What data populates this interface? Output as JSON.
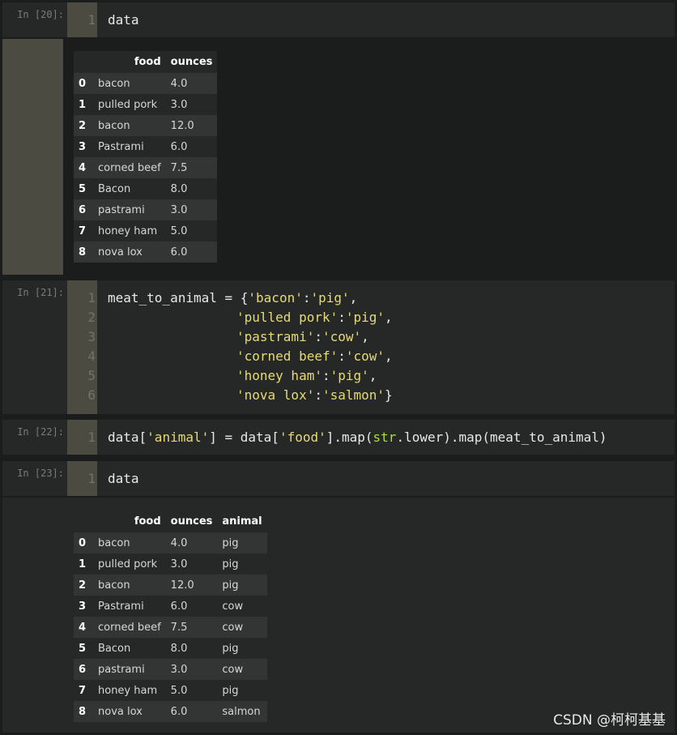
{
  "cells": [
    {
      "prompt": "In [20]:",
      "lines": [
        "1"
      ],
      "code": [
        "data"
      ]
    },
    {
      "prompt": "In [21]:",
      "lines": [
        "1",
        "2",
        "3",
        "4",
        "5",
        "6"
      ]
    },
    {
      "prompt": "In [22]:",
      "lines": [
        "1"
      ]
    },
    {
      "prompt": "In [23]:",
      "lines": [
        "1"
      ],
      "code": [
        "data"
      ]
    }
  ],
  "code21": {
    "l1a": "meat_to_animal ",
    "l1b": "= ",
    "l1c": "{",
    "l1d": "'bacon'",
    "l1e": ":",
    "l1f": "'pig'",
    "l1g": ",",
    "l2a": "'pulled pork'",
    "l2b": ":",
    "l2c": "'pig'",
    "l2d": ",",
    "l3a": "'pastrami'",
    "l3b": ":",
    "l3c": "'cow'",
    "l3d": ",",
    "l4a": "'corned beef'",
    "l4b": ":",
    "l4c": "'cow'",
    "l4d": ",",
    "l5a": "'honey ham'",
    "l5b": ":",
    "l5c": "'pig'",
    "l5d": ",",
    "l6a": "'nova lox'",
    "l6b": ":",
    "l6c": "'salmon'",
    "l6d": "}"
  },
  "code22": {
    "a": "data[",
    "b": "'animal'",
    "c": "] ",
    "d": "= ",
    "e": "data[",
    "f": "'food'",
    "g": "].map(",
    "h": "str",
    "i": ".lower).map(",
    "j": "meat_to_animal)"
  },
  "table1": {
    "headers": [
      "food",
      "ounces"
    ],
    "rows": [
      {
        "idx": "0",
        "food": "bacon",
        "ounces": "4.0"
      },
      {
        "idx": "1",
        "food": "pulled pork",
        "ounces": "3.0"
      },
      {
        "idx": "2",
        "food": "bacon",
        "ounces": "12.0"
      },
      {
        "idx": "3",
        "food": "Pastrami",
        "ounces": "6.0"
      },
      {
        "idx": "4",
        "food": "corned beef",
        "ounces": "7.5"
      },
      {
        "idx": "5",
        "food": "Bacon",
        "ounces": "8.0"
      },
      {
        "idx": "6",
        "food": "pastrami",
        "ounces": "3.0"
      },
      {
        "idx": "7",
        "food": "honey ham",
        "ounces": "5.0"
      },
      {
        "idx": "8",
        "food": "nova lox",
        "ounces": "6.0"
      }
    ]
  },
  "table2": {
    "headers": [
      "food",
      "ounces",
      "animal"
    ],
    "rows": [
      {
        "idx": "0",
        "food": "bacon",
        "ounces": "4.0",
        "animal": "pig"
      },
      {
        "idx": "1",
        "food": "pulled pork",
        "ounces": "3.0",
        "animal": "pig"
      },
      {
        "idx": "2",
        "food": "bacon",
        "ounces": "12.0",
        "animal": "pig"
      },
      {
        "idx": "3",
        "food": "Pastrami",
        "ounces": "6.0",
        "animal": "cow"
      },
      {
        "idx": "4",
        "food": "corned beef",
        "ounces": "7.5",
        "animal": "cow"
      },
      {
        "idx": "5",
        "food": "Bacon",
        "ounces": "8.0",
        "animal": "pig"
      },
      {
        "idx": "6",
        "food": "pastrami",
        "ounces": "3.0",
        "animal": "cow"
      },
      {
        "idx": "7",
        "food": "honey ham",
        "ounces": "5.0",
        "animal": "pig"
      },
      {
        "idx": "8",
        "food": "nova lox",
        "ounces": "6.0",
        "animal": "salmon"
      }
    ]
  },
  "watermark": "CSDN @柯柯基基",
  "colors": {
    "string": "#e6db74",
    "builtin": "#a6e22e",
    "background": "#1b1c1c",
    "cell": "#262727",
    "gutter": "#4b4b42"
  }
}
